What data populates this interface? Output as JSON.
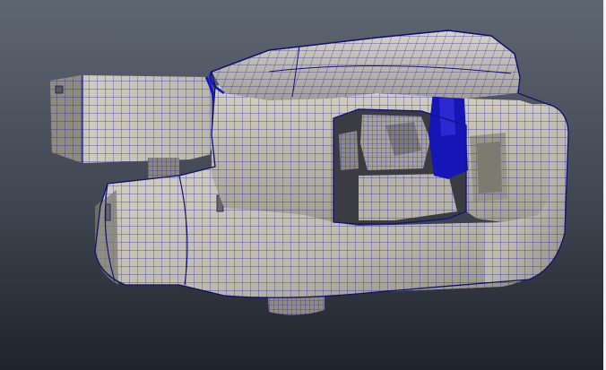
{
  "viewport": {
    "subject": "wireframe-mesh-model",
    "colors": {
      "bg_top": "#5e6672",
      "bg_bottom": "#1f232a",
      "surface_light": "#c9c5bb",
      "surface_mid": "#a9a598",
      "surface_dark": "#6f6c63",
      "cavity": "#3b3c42",
      "wire": "#1a1aa6",
      "wire_dense": "#1414c8",
      "edge_strip": "#f2f2f2"
    }
  }
}
